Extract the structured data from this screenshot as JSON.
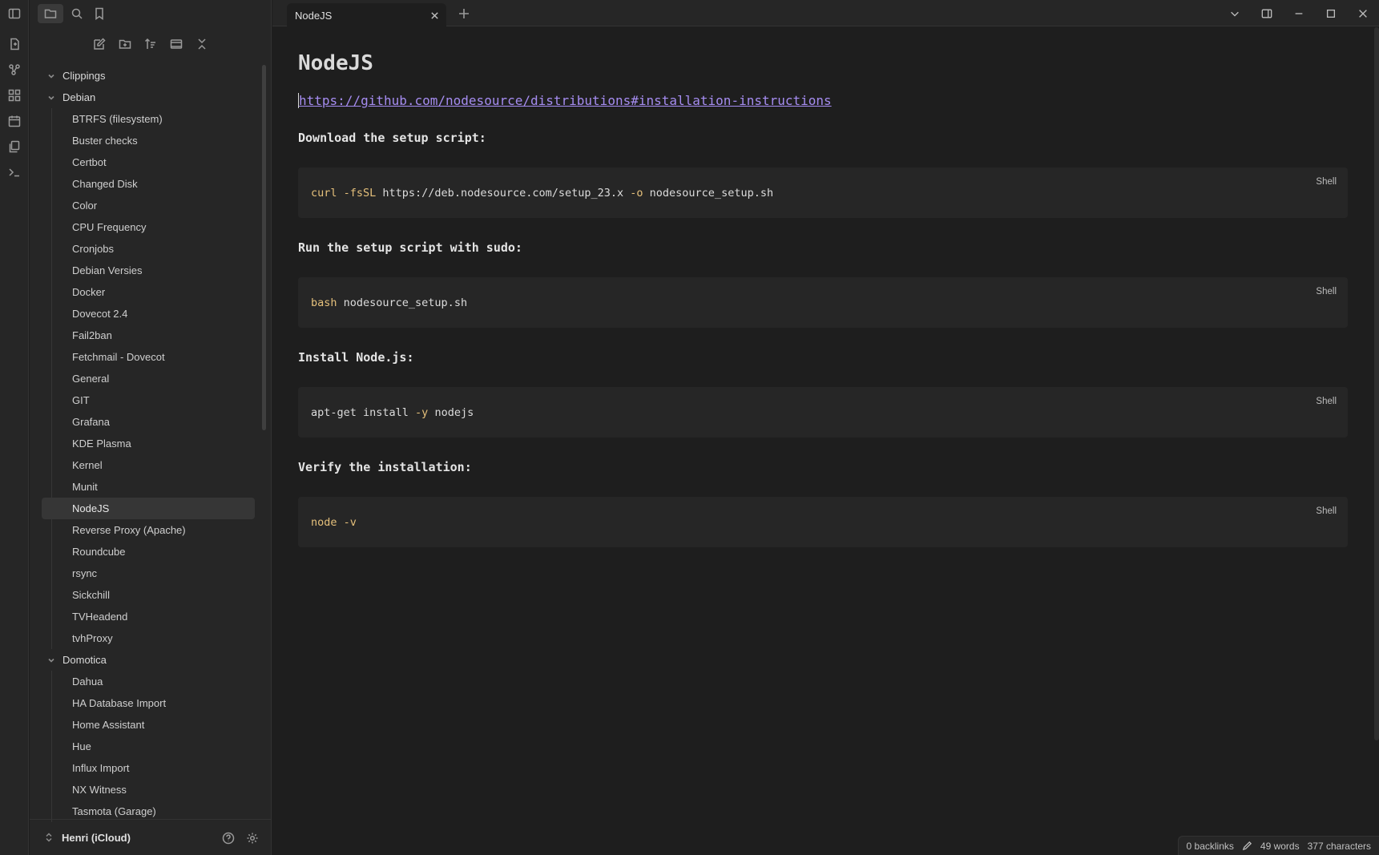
{
  "tab": {
    "title": "NodeJS"
  },
  "vault": {
    "name": "Henri (iCloud)"
  },
  "tree": {
    "clippings": "Clippings",
    "debian": {
      "label": "Debian",
      "items": [
        "BTRFS (filesystem)",
        "Buster checks",
        "Certbot",
        "Changed Disk",
        "Color",
        "CPU Frequency",
        "Cronjobs",
        "Debian Versies",
        "Docker",
        "Dovecot 2.4",
        "Fail2ban",
        "Fetchmail - Dovecot",
        "General",
        "GIT",
        "Grafana",
        "KDE Plasma",
        "Kernel",
        "Munit",
        "NodeJS",
        "Reverse Proxy (Apache)",
        "Roundcube",
        "rsync",
        "Sickchill",
        "TVHeadend",
        "tvhProxy"
      ]
    },
    "domotica": {
      "label": "Domotica",
      "items": [
        "Dahua",
        "HA Database Import",
        "Home Assistant",
        "Hue",
        "Influx Import",
        "NX Witness",
        "Tasmota (Garage)"
      ]
    }
  },
  "doc": {
    "title": "NodeJS",
    "link": "https://github.com/nodesource/distributions#installation-instructions",
    "sections": [
      {
        "heading": "Download the setup script:",
        "code_kw": "curl -fsSL",
        "code_rest": " https://deb.nodesource.com/setup_23.x ",
        "code_kw2": "-o",
        "code_rest2": " nodesource_setup.sh",
        "lang": "Shell"
      },
      {
        "heading": "Run the setup script with sudo:",
        "code_kw": "bash",
        "code_rest": " nodesource_setup.sh",
        "code_kw2": "",
        "code_rest2": "",
        "lang": "Shell"
      },
      {
        "heading": "Install Node.js:",
        "code_pre": "apt-get install ",
        "code_kw": "-y",
        "code_rest": " nodejs",
        "lang": "Shell"
      },
      {
        "heading": "Verify the installation:",
        "code_kw": "node -v",
        "lang": "Shell"
      }
    ]
  },
  "status": {
    "backlinks": "0 backlinks",
    "words": "49 words",
    "characters": "377 characters"
  },
  "colors": {
    "accent": "#a58cf0",
    "keyword": "#e5c07b",
    "background": "#1e1e1e",
    "panel": "#262626"
  }
}
